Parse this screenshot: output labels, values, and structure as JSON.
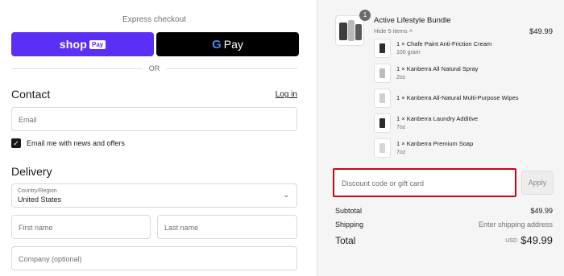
{
  "express": {
    "title": "Express checkout",
    "shop_pay": {
      "word": "shop",
      "tag": "Pay"
    },
    "google_pay": {
      "g": "G",
      "word": "Pay"
    },
    "or_text": "OR"
  },
  "contact": {
    "title": "Contact",
    "login_link": "Log in",
    "email_placeholder": "Email",
    "newsletter_label": "Email me with news and offers",
    "newsletter_checked": true
  },
  "delivery": {
    "title": "Delivery",
    "country_label": "Country/Region",
    "country_value": "United States",
    "first_name_placeholder": "First name",
    "last_name_placeholder": "Last name",
    "company_placeholder": "Company (optional)"
  },
  "order": {
    "bundle_quantity": "1",
    "bundle_title": "Active Lifestyle Bundle",
    "bundle_price": "$49.99",
    "hide_items_label": "Hide 5 items",
    "items": [
      {
        "name": "1 × Chafe Paint Anti-Friction Cream",
        "sub": "100 gram",
        "color": "#2e2e2e"
      },
      {
        "name": "1 × Kanberra All Natural Spray",
        "sub": "2oz",
        "color": "#bdbdbd"
      },
      {
        "name": "1 × Kanberra All-Natural Multi-Purpose Wipes",
        "sub": "",
        "color": "#cfcfcf"
      },
      {
        "name": "1 × Kanberra Laundry Additive",
        "sub": "7oz",
        "color": "#2a2a2a"
      },
      {
        "name": "1 × Kanberra Premium Soap",
        "sub": "7oz",
        "color": "#d6d6d6"
      }
    ]
  },
  "discount": {
    "placeholder": "Discount code or gift card",
    "apply_label": "Apply"
  },
  "summary": {
    "subtotal_label": "Subtotal",
    "subtotal_value": "$49.99",
    "shipping_label": "Shipping",
    "shipping_value": "Enter shipping address",
    "total_label": "Total",
    "total_currency": "USD",
    "total_value": "$49.99"
  },
  "colors": {
    "shop_pay": "#5a31f4",
    "google_pay": "#000000",
    "discount_highlight": "#d0021b",
    "sidebar_bg": "#f5f5f5"
  }
}
